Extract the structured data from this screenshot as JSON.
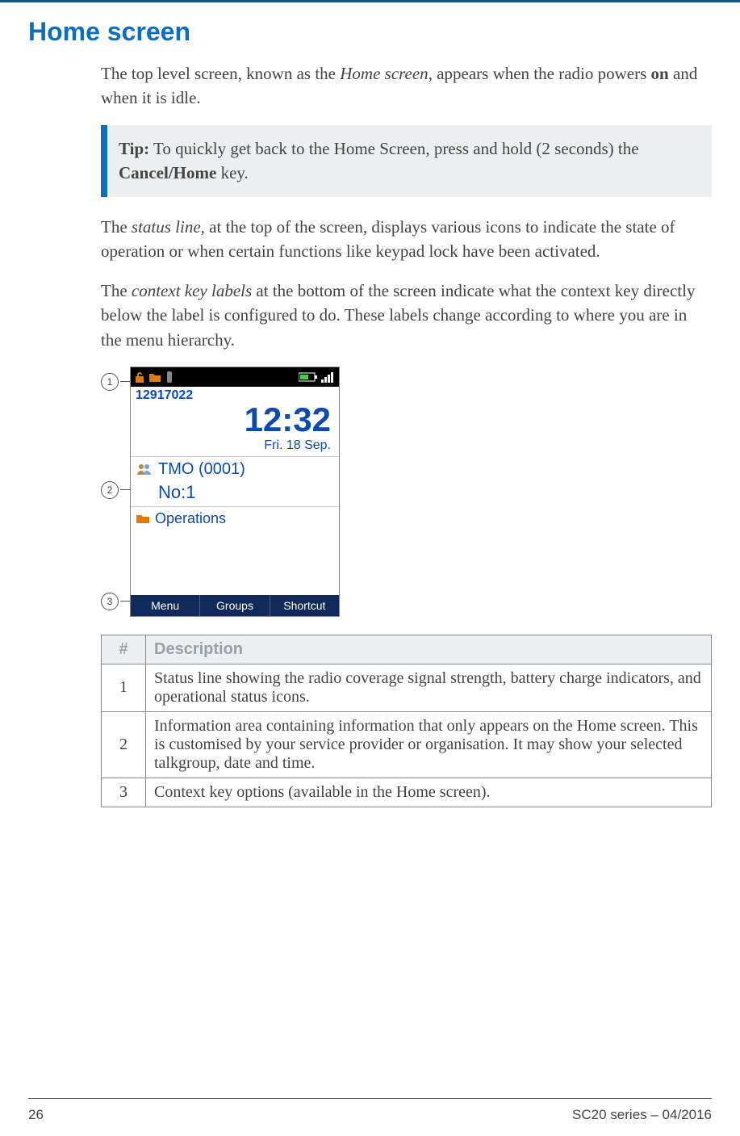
{
  "title": "Home screen",
  "paragraphs": {
    "intro_a": "The top level screen, known as the ",
    "intro_em": "Home screen",
    "intro_b": ", appears when the radio powers ",
    "intro_strong": "on",
    "intro_c": " and when it is idle.",
    "status_a": "The ",
    "status_em": "status line,",
    "status_b": " at the top of the screen, displays various icons to indicate the state of operation or when certain functions like keypad lock have been activated.",
    "context_a": "The ",
    "context_em": "context key labels",
    "context_b": " at the bottom of the screen indicate what the context key directly below the label is configured to do. These labels change according to where you are in the menu hierarchy."
  },
  "tip": {
    "label": "Tip:",
    "text_a": "  To quickly get back to the Home Screen, press and hold (2 seconds) the ",
    "strong": "Cancel/Home",
    "text_b": " key."
  },
  "callouts": [
    "1",
    "2",
    "3"
  ],
  "phone": {
    "radio_id": "12917022",
    "time": "12:32",
    "date": "Fri. 18 Sep.",
    "tmo": "TMO (0001)",
    "no": "No:1",
    "ops": "Operations",
    "context": [
      "Menu",
      "Groups",
      "Shortcut"
    ]
  },
  "table": {
    "headers": [
      "#",
      "Description"
    ],
    "rows": [
      {
        "n": "1",
        "d": "Status line showing the radio coverage signal strength, battery charge indicators, and operational status icons."
      },
      {
        "n": "2",
        "d": "Information area containing information that only appears on the Home screen. This is customised by your service provider or organisation. It may show your selected talkgroup, date and time."
      },
      {
        "n": "3",
        "d": "Context key options (available in the Home screen)."
      }
    ]
  },
  "footer": {
    "page": "26",
    "doc": "SC20 series – 04/2016"
  }
}
